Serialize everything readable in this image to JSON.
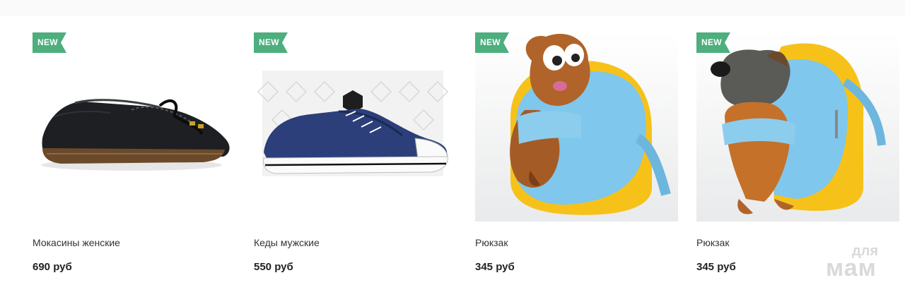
{
  "badge_text": "NEW",
  "accent_color": "#4caf7d",
  "currency": "руб",
  "products": [
    {
      "title": "Мокасины женские",
      "price": "690 руб",
      "image": "black-leather-loafer"
    },
    {
      "title": "Кеды мужские",
      "price": "550 руб",
      "image": "blue-denim-sneaker"
    },
    {
      "title": "Рюкзак",
      "price": "345 руб",
      "image": "plush-beaver-backpack"
    },
    {
      "title": "Рюкзак",
      "price": "345 руб",
      "image": "plush-dog-backpack"
    }
  ],
  "watermark": {
    "line1": "для",
    "line2": "мам"
  }
}
